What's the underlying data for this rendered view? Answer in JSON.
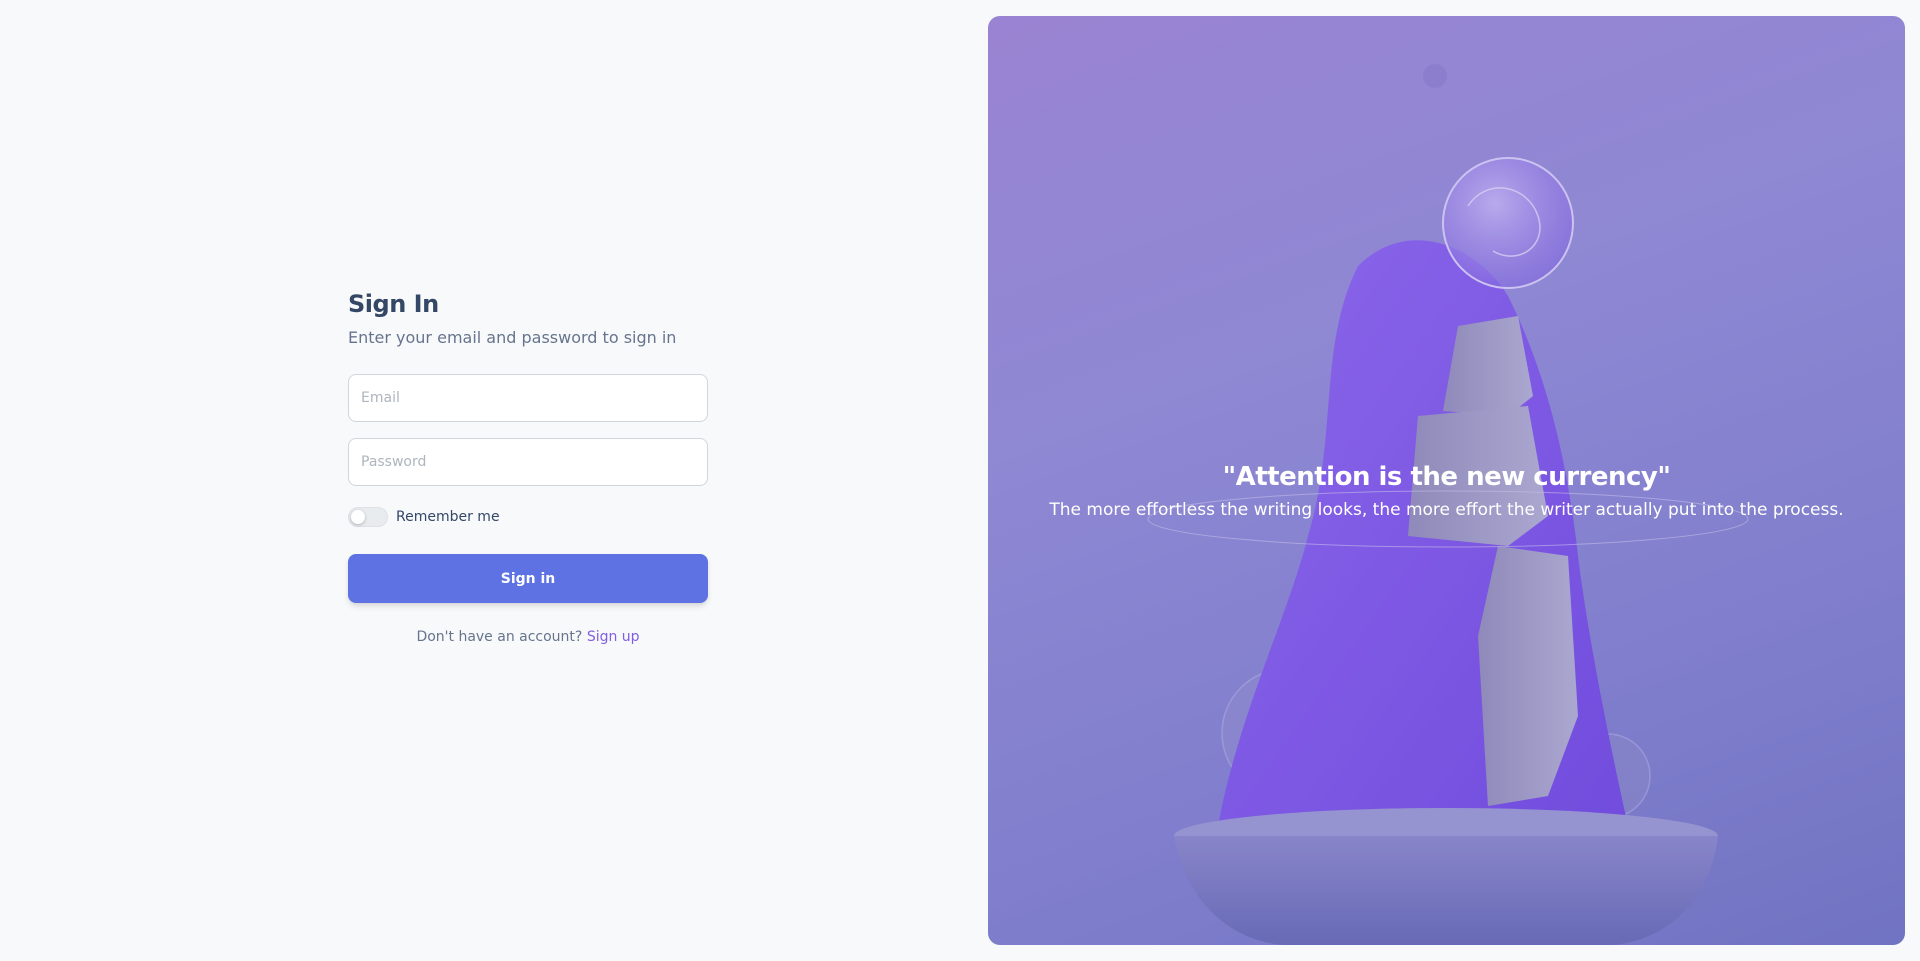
{
  "signin": {
    "title": "Sign In",
    "subtitle": "Enter your email and password to sign in",
    "email_placeholder": "Email",
    "password_placeholder": "Password",
    "remember_label": "Remember me",
    "remember_checked": false,
    "button_label": "Sign in",
    "signup_prompt": "Don't have an account?",
    "signup_link": "Sign up"
  },
  "hero": {
    "quote": "\"Attention is the new currency\"",
    "subtext": "The more effortless the writing looks, the more effort the writer actually put into the process."
  },
  "colors": {
    "background": "#f8f9fa",
    "primary": "#5e72e4",
    "link": "#825ee4",
    "heading": "#344767",
    "hero_overlay": "#8f88d4"
  }
}
